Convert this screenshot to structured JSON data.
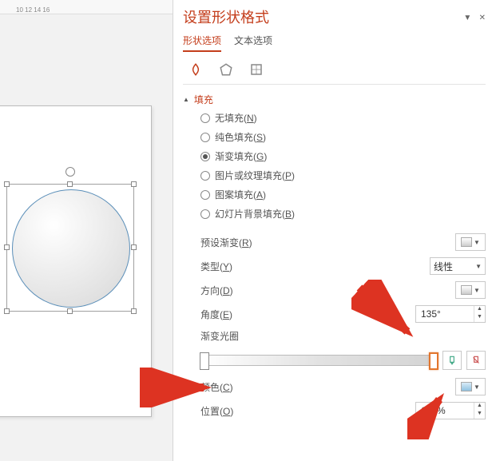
{
  "ruler_marks": "10      12      14      16",
  "panel": {
    "title": "设置形状格式",
    "tabs": {
      "shape": "形状选项",
      "text": "文本选项"
    },
    "fill_section": "填充",
    "radios": {
      "none": {
        "text": "无填充(",
        "key": "N",
        "suffix": ")"
      },
      "solid": {
        "text": "纯色填充(",
        "key": "S",
        "suffix": ")"
      },
      "grad": {
        "text": "渐变填充(",
        "key": "G",
        "suffix": ")"
      },
      "pic": {
        "text": "图片或纹理填充(",
        "key": "P",
        "suffix": ")"
      },
      "pattern": {
        "text": "图案填充(",
        "key": "A",
        "suffix": ")"
      },
      "slide": {
        "text": "幻灯片背景填充(",
        "key": "B",
        "suffix": ")"
      }
    },
    "preset": {
      "label": "预设渐变(",
      "key": "R",
      "suffix": ")"
    },
    "type": {
      "label": "类型(",
      "key": "Y",
      "suffix": ")",
      "value": "线性"
    },
    "direction": {
      "label": "方向(",
      "key": "D",
      "suffix": ")"
    },
    "angle": {
      "label": "角度(",
      "key": "E",
      "suffix": ")",
      "value": "135°"
    },
    "stops": "渐变光圈",
    "color": {
      "label": "颜色(",
      "key": "C",
      "suffix": ")"
    },
    "position": {
      "label": "位置(",
      "key": "O",
      "suffix": ")",
      "value": "100%"
    }
  }
}
